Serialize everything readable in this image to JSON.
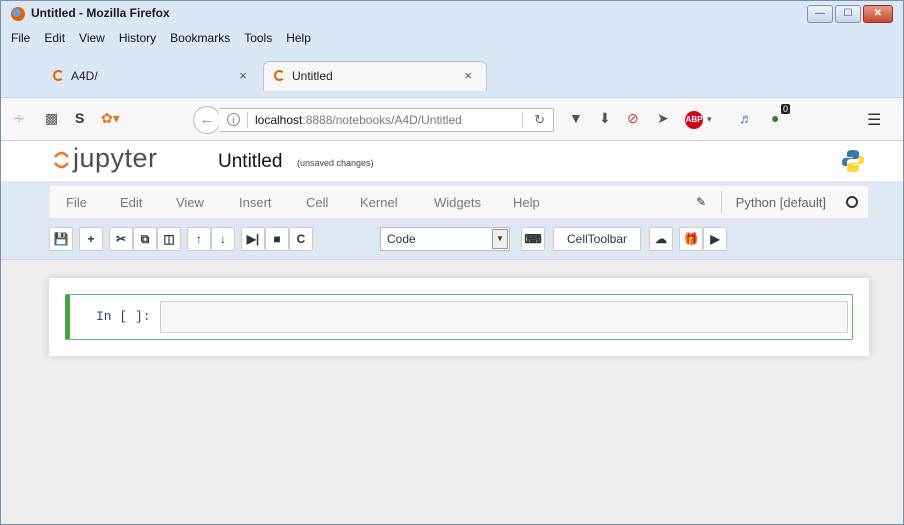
{
  "window": {
    "title": "Untitled - Mozilla Firefox",
    "controls": [
      "minimize",
      "maximize",
      "close"
    ]
  },
  "menubar": [
    "File",
    "Edit",
    "View",
    "History",
    "Bookmarks",
    "Tools",
    "Help"
  ],
  "tabs": [
    {
      "label": "A4D/",
      "active": false
    },
    {
      "label": "Untitled",
      "active": true
    }
  ],
  "navbar": {
    "url_host": "localhost",
    "url_rest": ":8888/notebooks/A4D/Untitled",
    "icons_left": [
      "rss-icon",
      "pocket-like-icon",
      "s-icon",
      "extension-icon"
    ],
    "icons_right": [
      "pocket-icon",
      "download-icon",
      "block-icon",
      "send-icon",
      "abp-icon",
      "bird-icon",
      "badge-icon",
      "hamburger-menu-icon"
    ],
    "badge_count": "0",
    "abp_label": "ABP"
  },
  "jupyter": {
    "logo_text": "jupyter",
    "notebook_name": "Untitled",
    "save_status": "(unsaved changes)",
    "menu": [
      "File",
      "Edit",
      "View",
      "Insert",
      "Cell",
      "Kernel",
      "Widgets",
      "Help"
    ],
    "kernel_name": "Python [default]",
    "toolbar": {
      "cell_type": "Code",
      "celltoolbar_label": "CellToolbar"
    },
    "cell": {
      "prompt": "In [ ]:",
      "source": ""
    }
  },
  "colors": {
    "cell_border": "#42a542",
    "prompt": "#303f9f",
    "window_chrome": "#dbe7f4"
  }
}
